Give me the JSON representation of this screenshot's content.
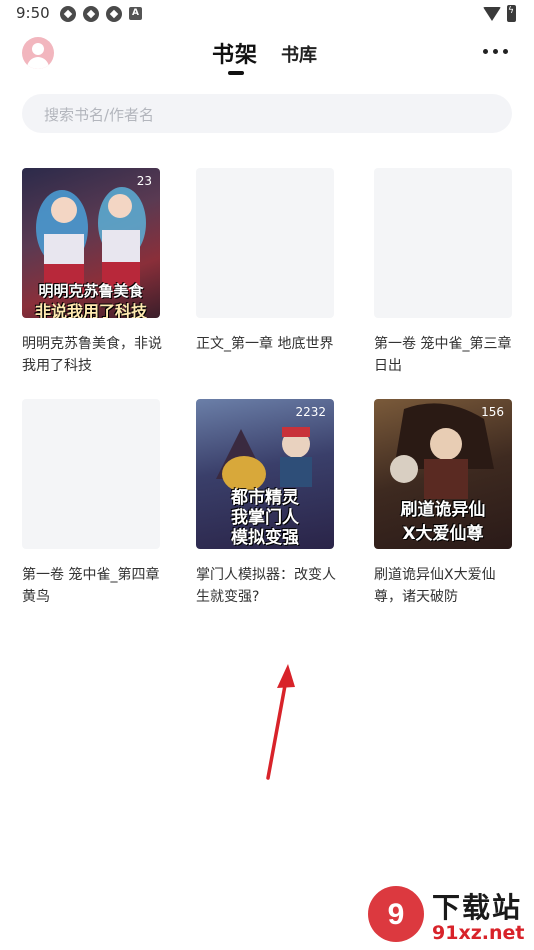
{
  "status_bar": {
    "time": "9:50",
    "notification_letter": "A"
  },
  "header": {
    "tabs": [
      {
        "label": "书架",
        "active": true
      },
      {
        "label": "书库",
        "active": false
      }
    ]
  },
  "search": {
    "placeholder": "搜索书名/作者名"
  },
  "books": [
    {
      "title": "明明克苏鲁美食，非说我用了科技",
      "badge": "23",
      "has_cover": true,
      "cover_text": [
        "明明克苏鲁美食",
        "非说我用了科技"
      ]
    },
    {
      "title": "正文_第一章 地底世界",
      "has_cover": false
    },
    {
      "title": "第一卷 笼中雀_第三章 日出",
      "has_cover": false
    },
    {
      "title": "第一卷 笼中雀_第四章 黄鸟",
      "has_cover": false
    },
    {
      "title": "掌门人模拟器：改变人生就变强?",
      "badge": "2232",
      "has_cover": true,
      "cover_text": [
        "都市精灵",
        "我掌门人",
        "模拟变强"
      ]
    },
    {
      "title": "刷道诡异仙X大爱仙尊，诸天破防",
      "badge": "156",
      "has_cover": true,
      "cover_text": [
        "刷道诡异仙",
        "X大爱仙尊"
      ]
    }
  ],
  "watermark": {
    "brand": "下载站",
    "url": "91xz.net"
  },
  "colors": {
    "accent_red": "#d8232a",
    "search_bg": "#f3f4f7",
    "avatar_pink": "#f2b6be"
  },
  "icons": [
    "user-avatar-icon",
    "more-dots-icon",
    "wifi-icon",
    "battery-icon",
    "red-arrow"
  ]
}
